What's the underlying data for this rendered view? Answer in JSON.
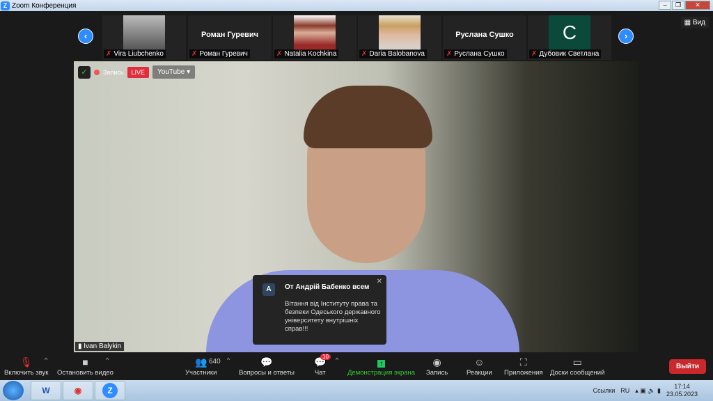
{
  "window": {
    "title": "Zoom Конференция"
  },
  "participants": [
    {
      "name": "Vira Liubchenko",
      "display": "photo"
    },
    {
      "name": "Роман Гуревич",
      "display": "Роман Гуревич"
    },
    {
      "name": "Natalia Kochkina",
      "display": "photo"
    },
    {
      "name": "Daria Balobanova",
      "display": "photo"
    },
    {
      "name": "Руслана Сушко",
      "display": "Руслана Сушко"
    },
    {
      "name": "Дубовик Светлана",
      "display": "C"
    }
  ],
  "view_label": "Вид",
  "video": {
    "record_label": "Запись",
    "live": "LIVE",
    "stream": "YouTube",
    "speaker": "Ivan Balykin"
  },
  "chat_popup": {
    "avatar": "A",
    "from": "От Андрій Бабенко всем",
    "message": "Вітання від Інституту права та безпеки Одеського державного університету внутрішніх справ!!!"
  },
  "toolbar": {
    "unmute": "Включить звук",
    "stop_video": "Остановить видео",
    "participants": "Участники",
    "participants_count": "640",
    "qa": "Вопросы и ответы",
    "chat": "Чат",
    "chat_badge": "10",
    "share": "Демонстрация экрана",
    "record": "Запись",
    "reactions": "Реакции",
    "apps": "Приложения",
    "whiteboards": "Доски сообщений",
    "leave": "Выйти"
  },
  "taskbar": {
    "links": "Ссылки",
    "lang": "RU",
    "time": "17:14",
    "date": "23.05.2023"
  },
  "colors": {
    "accent": "#2d8cff",
    "share_green": "#22c55e",
    "leave_red": "#c9282d"
  }
}
